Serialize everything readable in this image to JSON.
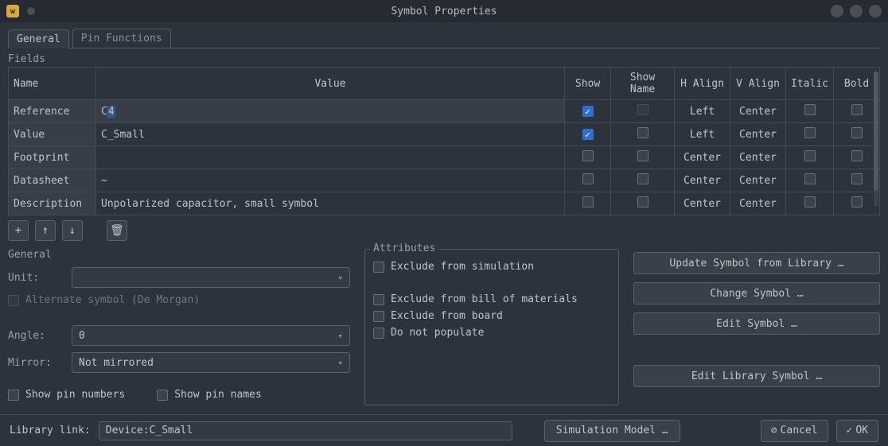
{
  "window": {
    "title": "Symbol Properties"
  },
  "tabs": {
    "general": "General",
    "pin_functions": "Pin Functions"
  },
  "fields_section": {
    "title": "Fields",
    "headers": {
      "name": "Name",
      "value": "Value",
      "show": "Show",
      "show_name": "Show Name",
      "h_align": "H Align",
      "v_align": "V Align",
      "italic": "Italic",
      "bold": "Bold"
    },
    "rows": [
      {
        "name": "Reference",
        "value_pref": "C",
        "value_sel": "4",
        "show": true,
        "show_name": false,
        "h": "Left",
        "v": "Center",
        "italic": false,
        "bold": false,
        "show_name_disabled": true
      },
      {
        "name": "Value",
        "value": "C_Small",
        "show": true,
        "show_name": false,
        "h": "Left",
        "v": "Center",
        "italic": false,
        "bold": false
      },
      {
        "name": "Footprint",
        "value": "",
        "show": false,
        "show_name": false,
        "h": "Center",
        "v": "Center",
        "italic": false,
        "bold": false
      },
      {
        "name": "Datasheet",
        "value": "~",
        "show": false,
        "show_name": false,
        "h": "Center",
        "v": "Center",
        "italic": false,
        "bold": false
      },
      {
        "name": "Description",
        "value": "Unpolarized capacitor, small symbol",
        "show": false,
        "show_name": false,
        "h": "Center",
        "v": "Center",
        "italic": false,
        "bold": false
      }
    ]
  },
  "general": {
    "title": "General",
    "unit_label": "Unit:",
    "unit_value": "",
    "alt_label": "Alternate symbol (De Morgan)",
    "angle_label": "Angle:",
    "angle_value": "0",
    "mirror_label": "Mirror:",
    "mirror_value": "Not mirrored",
    "show_pin_numbers": "Show pin numbers",
    "show_pin_names": "Show pin names"
  },
  "attributes": {
    "title": "Attributes",
    "exclude_sim": "Exclude from simulation",
    "exclude_bom": "Exclude from bill of materials",
    "exclude_board": "Exclude from board",
    "dnp": "Do not populate"
  },
  "actions": {
    "update": "Update Symbol from Library …",
    "change": "Change Symbol …",
    "edit": "Edit Symbol …",
    "edit_lib": "Edit Library Symbol …"
  },
  "bottom": {
    "lib_label": "Library link:",
    "lib_value": "Device:C_Small",
    "sim": "Simulation Model …",
    "cancel": "Cancel",
    "ok": "OK"
  }
}
